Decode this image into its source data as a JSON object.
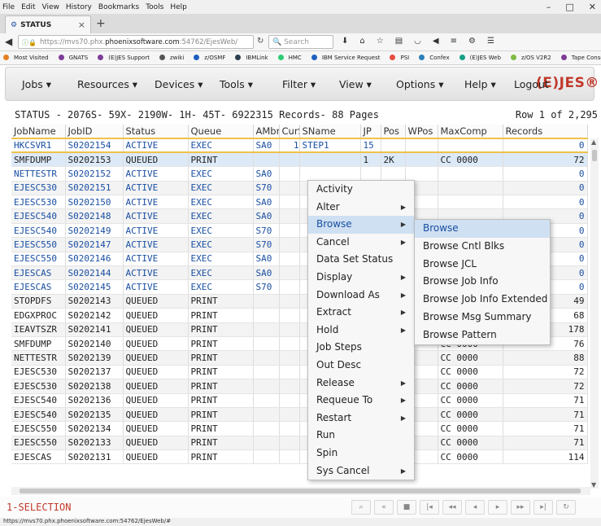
{
  "browser": {
    "menu": [
      "File",
      "Edit",
      "View",
      "History",
      "Bookmarks",
      "Tools",
      "Help"
    ],
    "window_controls": [
      "–",
      "□",
      "✕"
    ],
    "tab_title": "STATUS",
    "tab_close": "×",
    "new_tab": "+",
    "url_prefix": "https://mvs70.phx.",
    "url_domain": "phoenixsoftware.com",
    "url_suffix": ":54762/EjesWeb/",
    "search_placeholder": "Search",
    "bookmarks": [
      "Most Visited",
      "GNATS",
      "(E)JES Support",
      "zwiki",
      "z/OSMF",
      "IBMLink",
      "HMC",
      "IBM Service Request",
      "PSI",
      "Confex",
      "(E)JES Web",
      "z/OS V2R2",
      "Tape Console"
    ],
    "status_url": "https://mvs70.phx.phoenixsoftware.com:54762/EjesWeb/#"
  },
  "nav": {
    "items": [
      "Jobs ▾",
      "Resources ▾",
      "Devices ▾",
      "Tools ▾",
      "Filter ▾",
      "View ▾",
      "Options ▾",
      "Help ▾",
      "Logout"
    ],
    "brand": "(E)JES®"
  },
  "status": {
    "line": "STATUS - 2076S- 59X- 2190W- 1H- 45T- 6922315 Records- 88 Pages",
    "row_info": "Row 1 of 2,295"
  },
  "table": {
    "columns": [
      "JobName",
      "JobID",
      "Status",
      "Queue",
      "AMbr",
      "CurSt",
      "SName",
      "JP",
      "Pos",
      "WPos",
      "MaxComp",
      "Records"
    ],
    "rows": [
      [
        "HKCSVR1",
        "S0202154",
        "ACTIVE",
        "EXEC",
        "SA0",
        "1",
        "STEP1",
        "15",
        "",
        "",
        "",
        "0"
      ],
      [
        "SMFDUMP",
        "S0202153",
        "QUEUED",
        "PRINT",
        "",
        "",
        "",
        "1",
        "2K",
        "",
        "CC 0000",
        "72"
      ],
      [
        "NETTESTR",
        "S0202152",
        "ACTIVE",
        "EXEC",
        "SA0",
        "",
        "",
        "",
        "",
        "",
        "",
        "0"
      ],
      [
        "EJESC530",
        "S0202151",
        "ACTIVE",
        "EXEC",
        "S70",
        "",
        "",
        "",
        "",
        "",
        "",
        "0"
      ],
      [
        "EJESC530",
        "S0202150",
        "ACTIVE",
        "EXEC",
        "SA0",
        "",
        "",
        "",
        "",
        "",
        "",
        "0"
      ],
      [
        "EJESC540",
        "S0202148",
        "ACTIVE",
        "EXEC",
        "SA0",
        "",
        "",
        "",
        "",
        "",
        "",
        "0"
      ],
      [
        "EJESC540",
        "S0202149",
        "ACTIVE",
        "EXEC",
        "S70",
        "",
        "",
        "",
        "",
        "",
        "",
        "0"
      ],
      [
        "EJESC550",
        "S0202147",
        "ACTIVE",
        "EXEC",
        "S70",
        "",
        "",
        "",
        "",
        "",
        "",
        "0"
      ],
      [
        "EJESC550",
        "S0202146",
        "ACTIVE",
        "EXEC",
        "SA0",
        "",
        "",
        "",
        "",
        "",
        "",
        "0"
      ],
      [
        "EJESCAS",
        "S0202144",
        "ACTIVE",
        "EXEC",
        "SA0",
        "",
        "",
        "",
        "",
        "",
        "",
        "0"
      ],
      [
        "EJESCAS",
        "S0202145",
        "ACTIVE",
        "EXEC",
        "S70",
        "",
        "",
        "",
        "",
        "",
        "",
        "0"
      ],
      [
        "STOPDFS",
        "S0202143",
        "QUEUED",
        "PRINT",
        "",
        "",
        "",
        "",
        "",
        "",
        "",
        "49"
      ],
      [
        "EDGXPROC",
        "S0202142",
        "QUEUED",
        "PRINT",
        "",
        "",
        "",
        "",
        "",
        "",
        "",
        "68"
      ],
      [
        "IEAVTSZR",
        "S0202141",
        "QUEUED",
        "PRINT",
        "",
        "",
        "",
        "",
        "",
        "",
        "",
        "178"
      ],
      [
        "SMFDUMP",
        "S0202140",
        "QUEUED",
        "PRINT",
        "",
        "",
        "",
        "",
        "2K",
        "",
        "CC 0000",
        "76"
      ],
      [
        "NETTESTR",
        "S0202139",
        "QUEUED",
        "PRINT",
        "",
        "",
        "",
        "",
        "2K",
        "",
        "CC 0000",
        "88"
      ],
      [
        "EJESC530",
        "S0202137",
        "QUEUED",
        "PRINT",
        "",
        "",
        "",
        "",
        "2K",
        "",
        "CC 0000",
        "72"
      ],
      [
        "EJESC530",
        "S0202138",
        "QUEUED",
        "PRINT",
        "",
        "",
        "",
        "",
        "2K",
        "",
        "CC 0000",
        "72"
      ],
      [
        "EJESC540",
        "S0202136",
        "QUEUED",
        "PRINT",
        "",
        "",
        "",
        "",
        "2K",
        "",
        "CC 0000",
        "71"
      ],
      [
        "EJESC540",
        "S0202135",
        "QUEUED",
        "PRINT",
        "",
        "",
        "",
        "",
        "2K",
        "",
        "CC 0000",
        "71"
      ],
      [
        "EJESC550",
        "S0202134",
        "QUEUED",
        "PRINT",
        "",
        "",
        "",
        "",
        "2K",
        "",
        "CC 0000",
        "71"
      ],
      [
        "EJESC550",
        "S0202133",
        "QUEUED",
        "PRINT",
        "",
        "",
        "",
        "",
        "2K",
        "",
        "CC 0000",
        "71"
      ],
      [
        "EJESCAS",
        "S0202131",
        "QUEUED",
        "PRINT",
        "",
        "",
        "",
        "",
        "2K",
        "",
        "CC 0000",
        "114"
      ]
    ]
  },
  "context_menu": {
    "items": [
      {
        "label": "Activity",
        "sub": false
      },
      {
        "label": "Alter",
        "sub": true
      },
      {
        "label": "Browse",
        "sub": true,
        "active": true
      },
      {
        "label": "Cancel",
        "sub": true
      },
      {
        "label": "Data Set Status",
        "sub": false
      },
      {
        "label": "Display",
        "sub": true
      },
      {
        "label": "Download As",
        "sub": true
      },
      {
        "label": "Extract",
        "sub": true
      },
      {
        "label": "Hold",
        "sub": true
      },
      {
        "label": "Job Steps",
        "sub": false
      },
      {
        "label": "Out Desc",
        "sub": false
      },
      {
        "label": "Release",
        "sub": true
      },
      {
        "label": "Requeue To",
        "sub": true
      },
      {
        "label": "Restart",
        "sub": true
      },
      {
        "label": "Run",
        "sub": false
      },
      {
        "label": "Spin",
        "sub": false
      },
      {
        "label": "Sys Cancel",
        "sub": true
      }
    ],
    "browse_submenu": [
      "Browse",
      "Browse Cntl Blks",
      "Browse JCL",
      "Browse Job Info",
      "Browse Job Info Extended",
      "Browse Msg Summary",
      "Browse Pattern"
    ]
  },
  "footer": {
    "selection_label": "1-SELECTION",
    "pager": [
      "⌕",
      "«",
      "■",
      "|◂",
      "◂◂",
      "◂",
      "▸",
      "▸▸",
      "▸|",
      "↻"
    ]
  },
  "colors": {
    "brand": "#c0392b",
    "active_job": "#1a4fa3",
    "selected_row": "#dce9f7",
    "first_row_border": "#f0c24b"
  }
}
